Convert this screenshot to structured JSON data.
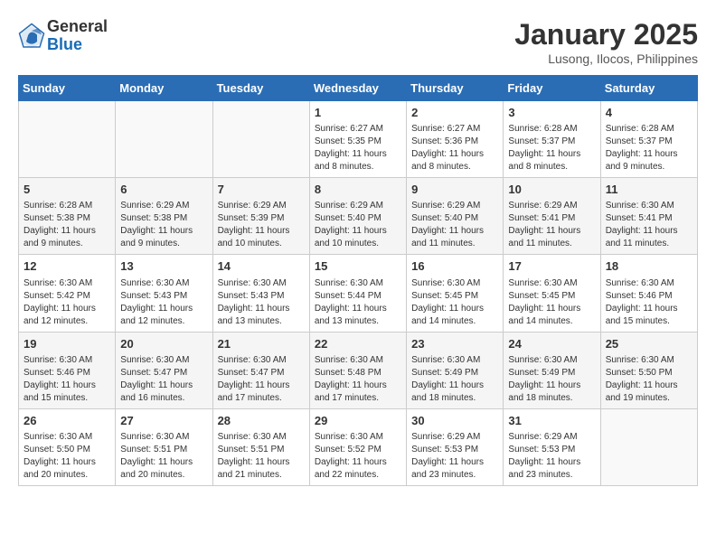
{
  "header": {
    "logo_line1": "General",
    "logo_line2": "Blue",
    "month_title": "January 2025",
    "location": "Lusong, Ilocos, Philippines"
  },
  "weekdays": [
    "Sunday",
    "Monday",
    "Tuesday",
    "Wednesday",
    "Thursday",
    "Friday",
    "Saturday"
  ],
  "weeks": [
    [
      {
        "day": "",
        "info": ""
      },
      {
        "day": "",
        "info": ""
      },
      {
        "day": "",
        "info": ""
      },
      {
        "day": "1",
        "info": "Sunrise: 6:27 AM\nSunset: 5:35 PM\nDaylight: 11 hours and 8 minutes."
      },
      {
        "day": "2",
        "info": "Sunrise: 6:27 AM\nSunset: 5:36 PM\nDaylight: 11 hours and 8 minutes."
      },
      {
        "day": "3",
        "info": "Sunrise: 6:28 AM\nSunset: 5:37 PM\nDaylight: 11 hours and 8 minutes."
      },
      {
        "day": "4",
        "info": "Sunrise: 6:28 AM\nSunset: 5:37 PM\nDaylight: 11 hours and 9 minutes."
      }
    ],
    [
      {
        "day": "5",
        "info": "Sunrise: 6:28 AM\nSunset: 5:38 PM\nDaylight: 11 hours and 9 minutes."
      },
      {
        "day": "6",
        "info": "Sunrise: 6:29 AM\nSunset: 5:38 PM\nDaylight: 11 hours and 9 minutes."
      },
      {
        "day": "7",
        "info": "Sunrise: 6:29 AM\nSunset: 5:39 PM\nDaylight: 11 hours and 10 minutes."
      },
      {
        "day": "8",
        "info": "Sunrise: 6:29 AM\nSunset: 5:40 PM\nDaylight: 11 hours and 10 minutes."
      },
      {
        "day": "9",
        "info": "Sunrise: 6:29 AM\nSunset: 5:40 PM\nDaylight: 11 hours and 11 minutes."
      },
      {
        "day": "10",
        "info": "Sunrise: 6:29 AM\nSunset: 5:41 PM\nDaylight: 11 hours and 11 minutes."
      },
      {
        "day": "11",
        "info": "Sunrise: 6:30 AM\nSunset: 5:41 PM\nDaylight: 11 hours and 11 minutes."
      }
    ],
    [
      {
        "day": "12",
        "info": "Sunrise: 6:30 AM\nSunset: 5:42 PM\nDaylight: 11 hours and 12 minutes."
      },
      {
        "day": "13",
        "info": "Sunrise: 6:30 AM\nSunset: 5:43 PM\nDaylight: 11 hours and 12 minutes."
      },
      {
        "day": "14",
        "info": "Sunrise: 6:30 AM\nSunset: 5:43 PM\nDaylight: 11 hours and 13 minutes."
      },
      {
        "day": "15",
        "info": "Sunrise: 6:30 AM\nSunset: 5:44 PM\nDaylight: 11 hours and 13 minutes."
      },
      {
        "day": "16",
        "info": "Sunrise: 6:30 AM\nSunset: 5:45 PM\nDaylight: 11 hours and 14 minutes."
      },
      {
        "day": "17",
        "info": "Sunrise: 6:30 AM\nSunset: 5:45 PM\nDaylight: 11 hours and 14 minutes."
      },
      {
        "day": "18",
        "info": "Sunrise: 6:30 AM\nSunset: 5:46 PM\nDaylight: 11 hours and 15 minutes."
      }
    ],
    [
      {
        "day": "19",
        "info": "Sunrise: 6:30 AM\nSunset: 5:46 PM\nDaylight: 11 hours and 15 minutes."
      },
      {
        "day": "20",
        "info": "Sunrise: 6:30 AM\nSunset: 5:47 PM\nDaylight: 11 hours and 16 minutes."
      },
      {
        "day": "21",
        "info": "Sunrise: 6:30 AM\nSunset: 5:47 PM\nDaylight: 11 hours and 17 minutes."
      },
      {
        "day": "22",
        "info": "Sunrise: 6:30 AM\nSunset: 5:48 PM\nDaylight: 11 hours and 17 minutes."
      },
      {
        "day": "23",
        "info": "Sunrise: 6:30 AM\nSunset: 5:49 PM\nDaylight: 11 hours and 18 minutes."
      },
      {
        "day": "24",
        "info": "Sunrise: 6:30 AM\nSunset: 5:49 PM\nDaylight: 11 hours and 18 minutes."
      },
      {
        "day": "25",
        "info": "Sunrise: 6:30 AM\nSunset: 5:50 PM\nDaylight: 11 hours and 19 minutes."
      }
    ],
    [
      {
        "day": "26",
        "info": "Sunrise: 6:30 AM\nSunset: 5:50 PM\nDaylight: 11 hours and 20 minutes."
      },
      {
        "day": "27",
        "info": "Sunrise: 6:30 AM\nSunset: 5:51 PM\nDaylight: 11 hours and 20 minutes."
      },
      {
        "day": "28",
        "info": "Sunrise: 6:30 AM\nSunset: 5:51 PM\nDaylight: 11 hours and 21 minutes."
      },
      {
        "day": "29",
        "info": "Sunrise: 6:30 AM\nSunset: 5:52 PM\nDaylight: 11 hours and 22 minutes."
      },
      {
        "day": "30",
        "info": "Sunrise: 6:29 AM\nSunset: 5:53 PM\nDaylight: 11 hours and 23 minutes."
      },
      {
        "day": "31",
        "info": "Sunrise: 6:29 AM\nSunset: 5:53 PM\nDaylight: 11 hours and 23 minutes."
      },
      {
        "day": "",
        "info": ""
      }
    ]
  ]
}
